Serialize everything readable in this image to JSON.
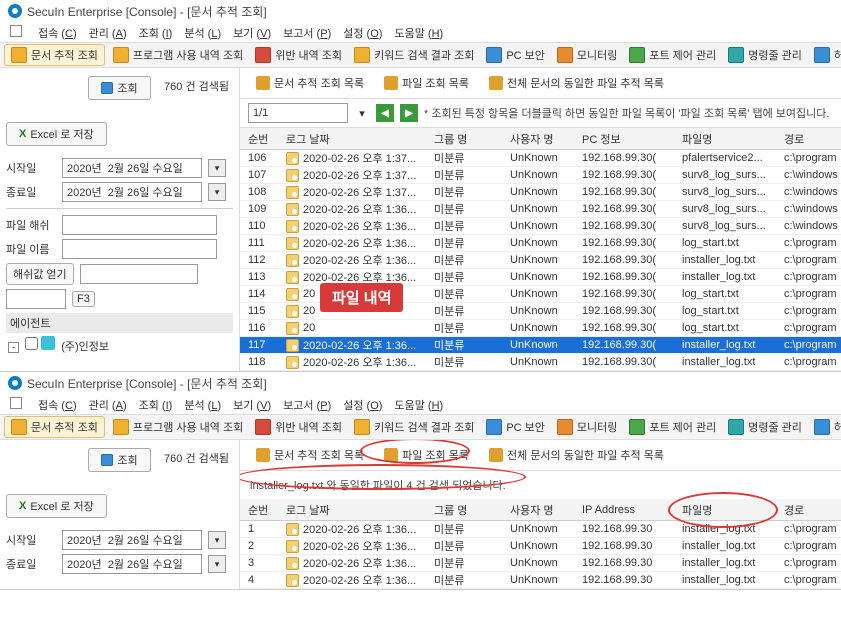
{
  "title": "SecuIn Enterprise [Console] - [문서 추적 조회]",
  "menu": {
    "connect": "접속",
    "connect_k": "C",
    "manage": "관리",
    "manage_k": "A",
    "query": "조회",
    "query_k": "I",
    "analyze": "분석",
    "analyze_k": "L",
    "view": "보기",
    "view_k": "V",
    "report": "보고서",
    "report_k": "P",
    "settings": "설정",
    "settings_k": "O",
    "help": "도움말",
    "help_k": "H"
  },
  "toolbar": {
    "t0": "문서 추적 조회",
    "t1": "프로그램 사용 내역 조회",
    "t2": "위반 내역 조회",
    "t3": "키워드 검색 결과 조회",
    "t4": "PC 보안",
    "t5": "모니터링",
    "t6": "포트 제어 관리",
    "t7": "명령줄 관리",
    "t8": "허용 USB 정책"
  },
  "side": {
    "query": "조회",
    "count": "760 건 검색됨",
    "count2": "760 건 검색됨",
    "excel": "Excel 로 저장",
    "start": "시작일",
    "end": "종료일",
    "date": "2020년  2월 26일 수요일",
    "hash": "파일 해쉬",
    "fname": "파일 이름",
    "hashcalc": "해쉬값 얻기",
    "f3": "F3",
    "agent": "에이전트",
    "agent1": "(주)인정보"
  },
  "tabs": {
    "a": "문서 추적 조회 목록",
    "b": "파일 조회 목록",
    "c": "전체 문서의 동일한 파일 추적 목록"
  },
  "pager": {
    "page": "1/1",
    "hint": "* 조회된 특정 항목을 더블클릭 하면 동일한 파일 목록이 '파일 조회 목록' 탭에 보여집니다."
  },
  "cols": {
    "no": "순번",
    "date": "로그 날짜",
    "grp": "그룹 명",
    "usr": "사용자 명",
    "pc": "PC 정보",
    "ip": "IP Address",
    "fn": "파일명",
    "path": "경로"
  },
  "grp": "미분류",
  "usr": "UnKnown",
  "pc": "192.168.99.30(",
  "ip": "192.168.99.30",
  "rows1": [
    {
      "no": "106",
      "d": "2020-02-26 오후 1:37...",
      "fn": "pfalertservice2...",
      "p": "c:\\program"
    },
    {
      "no": "107",
      "d": "2020-02-26 오후 1:37...",
      "fn": "surv8_log_surs...",
      "p": "c:\\windows"
    },
    {
      "no": "108",
      "d": "2020-02-26 오후 1:37...",
      "fn": "surv8_log_surs...",
      "p": "c:\\windows"
    },
    {
      "no": "109",
      "d": "2020-02-26 오후 1:36...",
      "fn": "surv8_log_surs...",
      "p": "c:\\windows"
    },
    {
      "no": "110",
      "d": "2020-02-26 오후 1:36...",
      "fn": "surv8_log_surs...",
      "p": "c:\\windows"
    },
    {
      "no": "111",
      "d": "2020-02-26 오후 1:36...",
      "fn": "log_start.txt",
      "p": "c:\\program"
    },
    {
      "no": "112",
      "d": "2020-02-26 오후 1:36...",
      "fn": "installer_log.txt",
      "p": "c:\\program"
    },
    {
      "no": "113",
      "d": "2020-02-26 오후 1:36...",
      "fn": "installer_log.txt",
      "p": "c:\\program"
    },
    {
      "no": "114",
      "d": "20",
      "fn": "log_start.txt",
      "p": "c:\\program"
    },
    {
      "no": "115",
      "d": "20",
      "fn": "log_start.txt",
      "p": "c:\\program"
    },
    {
      "no": "116",
      "d": "20",
      "fn": "log_start.txt",
      "p": "c:\\program"
    },
    {
      "no": "117",
      "d": "2020-02-26 오후 1:36...",
      "fn": "installer_log.txt",
      "p": "c:\\program"
    },
    {
      "no": "118",
      "d": "2020-02-26 오후 1:36...",
      "fn": "installer_log.txt",
      "p": "c:\\program"
    }
  ],
  "badge": "파일 내역",
  "status2": "installer_log.txt 와 동일한 파일이 4 건 검색 되었습니다.",
  "rows2": [
    {
      "no": "1",
      "d": "2020-02-26 오후 1:36...",
      "fn": "installer_log.txt",
      "p": "c:\\program"
    },
    {
      "no": "2",
      "d": "2020-02-26 오후 1:36...",
      "fn": "installer_log.txt",
      "p": "c:\\program"
    },
    {
      "no": "3",
      "d": "2020-02-26 오후 1:36...",
      "fn": "installer_log.txt",
      "p": "c:\\program"
    },
    {
      "no": "4",
      "d": "2020-02-26 오후 1:36...",
      "fn": "installer_log.txt",
      "p": "c:\\program"
    }
  ]
}
